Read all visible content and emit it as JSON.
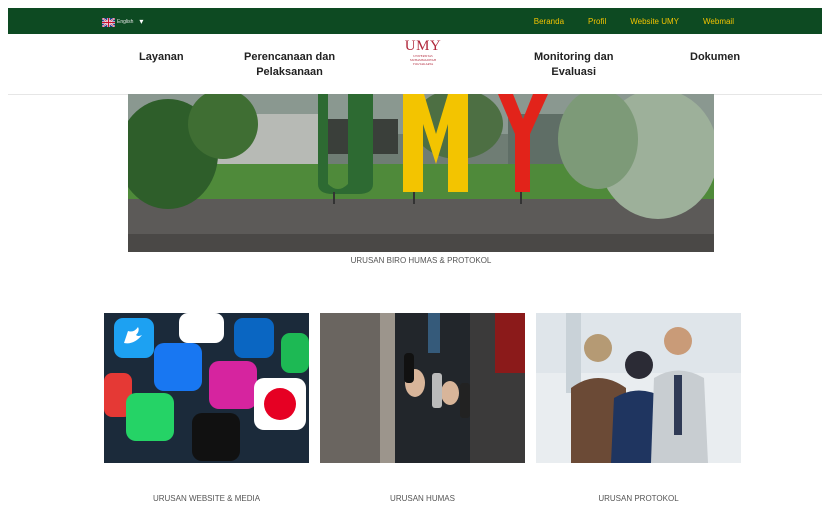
{
  "topbar": {
    "language": "English",
    "links": [
      "Beranda",
      "Profil",
      "Website UMY",
      "Webmail"
    ]
  },
  "logo": {
    "title": "UMY",
    "subtitle_lines": [
      "UNIVERSITAS",
      "MUHAMMADIYAH",
      "YOGYAKARTA"
    ]
  },
  "nav": {
    "layanan": "Layanan",
    "perencanaan_line1": "Perencanaan dan",
    "perencanaan_line2": "Pelaksanaan",
    "monitoring_line1": "Monitoring dan",
    "monitoring_line2": "Evaluasi",
    "dokumen": "Dokumen"
  },
  "hero": {
    "caption": "URUSAN BIRO HUMAS & PROTOKOL",
    "sign_letters": [
      "U",
      "M",
      "Y"
    ]
  },
  "cards": [
    {
      "caption": "URUSAN WEBSITE & MEDIA",
      "app_labels": [
        "Twitter",
        "Google",
        "LinkedIn",
        "Spotify",
        "Facebook",
        "Instagram",
        "WhatsApp",
        "TikTok",
        "Pinterest"
      ]
    },
    {
      "caption": "URUSAN HUMAS"
    },
    {
      "caption": "URUSAN PROTOKOL"
    }
  ],
  "colors": {
    "topbar_bg": "#0d4a22",
    "topbar_link": "#f2c300",
    "logo_red": "#b0273a"
  }
}
